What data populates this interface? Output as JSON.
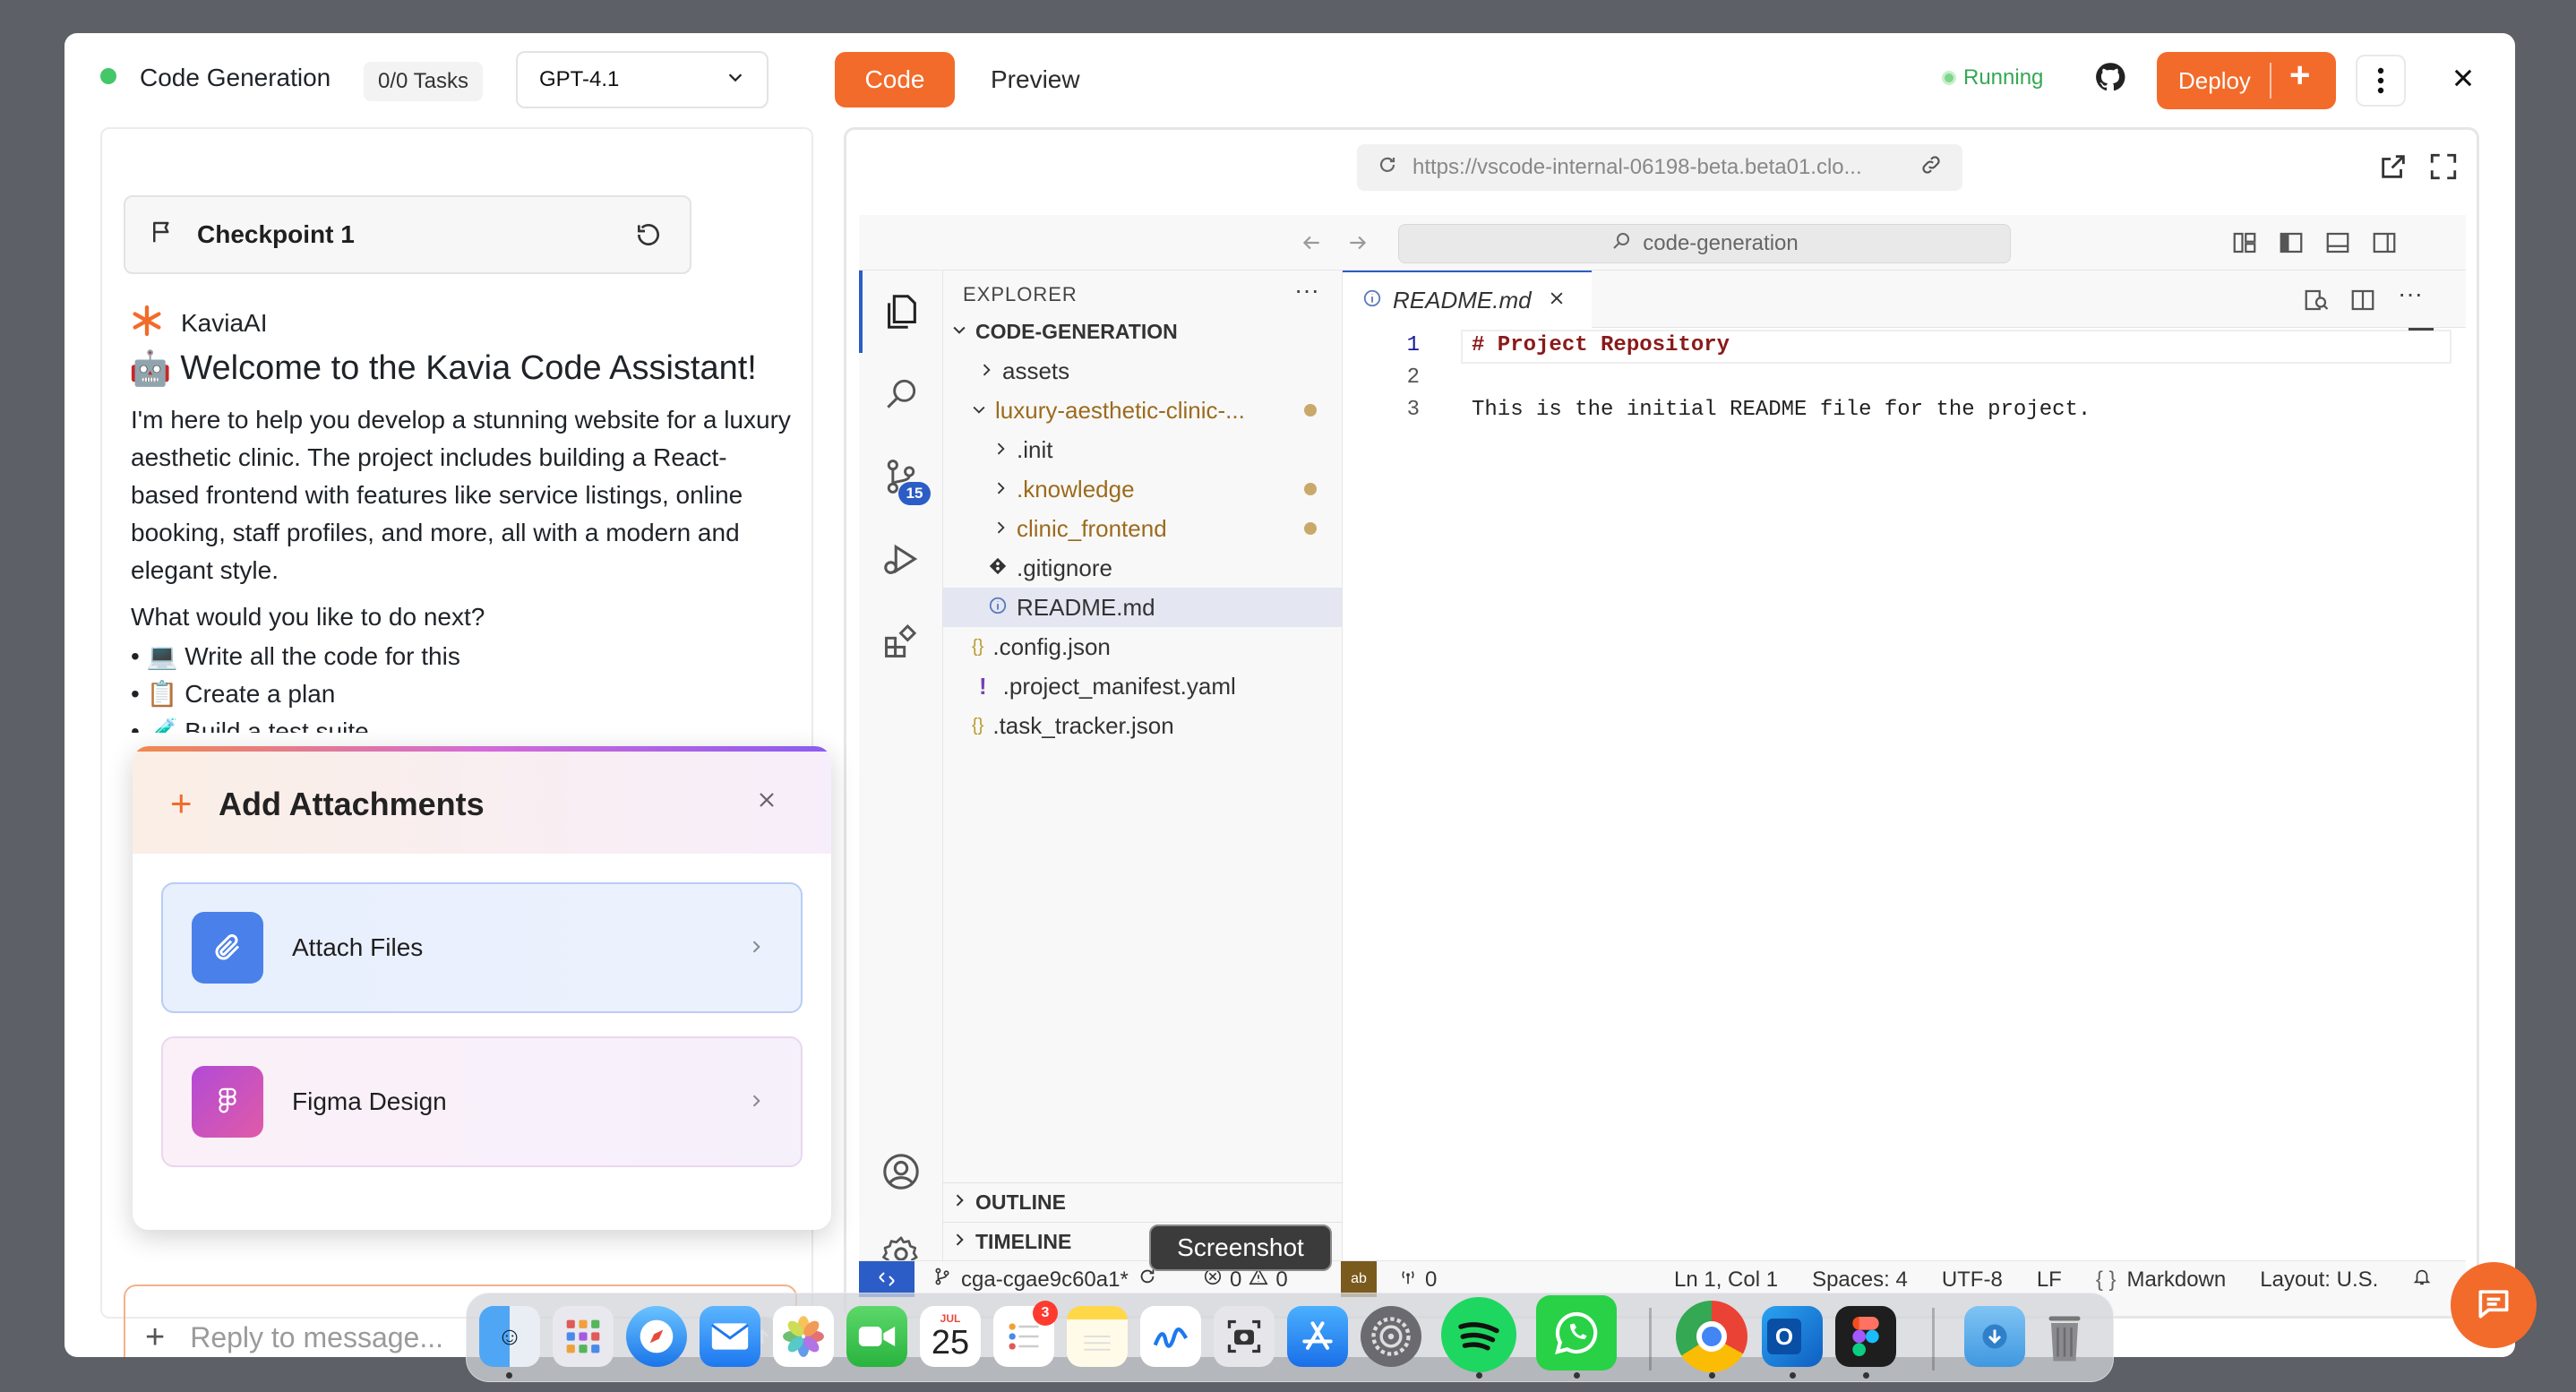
{
  "header": {
    "title": "Code Generation",
    "tasks_badge": "0/0 Tasks",
    "model_select": "GPT-4.1",
    "tab_code": "Code",
    "tab_preview": "Preview",
    "status": "Running",
    "deploy_label": "Deploy"
  },
  "chat": {
    "checkpoint_label": "Checkpoint 1",
    "sender": "KaviaAI",
    "welcome_emoji": "🤖",
    "welcome_title": "Welcome to the Kavia Code Assistant!",
    "intro": "I'm here to help you develop a stunning website for a luxury aesthetic clinic. The project includes building a React-based frontend with features like service listings, online booking, staff profiles, and more, all with a modern and elegant style.",
    "question": "What would you like to do next?",
    "options": [
      "💻 Write all the code for this",
      "📋 Create a plan",
      "🧪 Build a test suite"
    ],
    "reply_placeholder": "Reply to message..."
  },
  "attachments_popup": {
    "title": "Add Attachments",
    "items": [
      {
        "label": "Attach Files"
      },
      {
        "label": "Figma Design"
      }
    ]
  },
  "preview": {
    "url": "https://vscode-internal-06198-beta.beta01.clo..."
  },
  "vscode": {
    "search": "code-generation",
    "explorer_title": "EXPLORER",
    "root_folder": "CODE-GENERATION",
    "scm_badge": "15",
    "tree": [
      {
        "label": "assets",
        "type": "folder"
      },
      {
        "label": "luxury-aesthetic-clinic-...",
        "type": "folder-open",
        "modified": true
      },
      {
        "label": ".init",
        "type": "folder"
      },
      {
        "label": ".knowledge",
        "type": "folder",
        "modified": true
      },
      {
        "label": "clinic_frontend",
        "type": "folder",
        "modified": true
      },
      {
        "label": ".gitignore",
        "type": "file"
      },
      {
        "label": "README.md",
        "type": "file",
        "selected": true
      },
      {
        "label": ".config.json",
        "type": "json"
      },
      {
        "label": ".project_manifest.yaml",
        "type": "yaml"
      },
      {
        "label": ".task_tracker.json",
        "type": "json"
      }
    ],
    "outline": "OUTLINE",
    "timeline": "TIMELINE",
    "editor_tab": "README.md",
    "code_lines": [
      {
        "num": "1",
        "text": "# Project Repository"
      },
      {
        "num": "2",
        "text": ""
      },
      {
        "num": "3",
        "text": "This is the initial README file for the project."
      }
    ],
    "statusbar": {
      "branch": "cga-cgae9c60a1*",
      "errors": "0",
      "warnings": "0",
      "ports": "0",
      "position": "Ln 1, Col 1",
      "spaces": "Spaces: 4",
      "encoding": "UTF-8",
      "eol": "LF",
      "language": "Markdown",
      "layout": "Layout: U.S."
    }
  },
  "tooltip": "Screenshot",
  "dock": {
    "calendar_month": "JUL",
    "calendar_day": "25",
    "reminders_badge": "3"
  },
  "colors": {
    "accent": "#f26b2b",
    "running_green": "#34a853",
    "vscode_blue": "#2c5cc5"
  }
}
